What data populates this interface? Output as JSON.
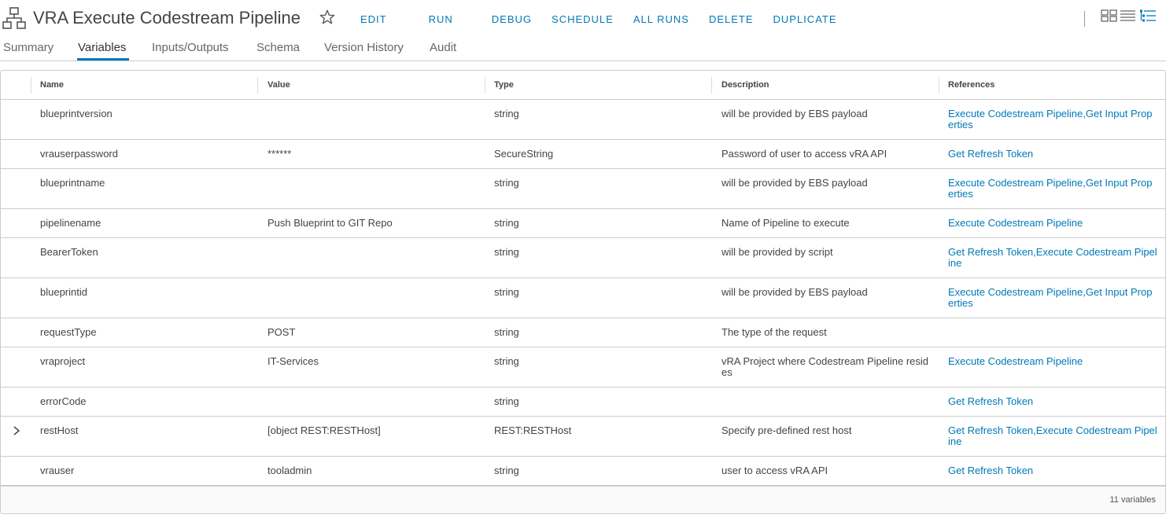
{
  "header": {
    "title": "VRA Execute Codestream Pipeline",
    "actions": [
      "EDIT",
      "RUN",
      "DEBUG",
      "SCHEDULE",
      "ALL RUNS",
      "DELETE",
      "DUPLICATE"
    ],
    "icons": [
      "workflow-icon",
      "star-icon",
      "card-view-icon",
      "list-view-icon",
      "detail-view-icon"
    ]
  },
  "tabs": [
    "Summary",
    "Variables",
    "Inputs/Outputs",
    "Schema",
    "Version History",
    "Audit"
  ],
  "active_tab": "Variables",
  "table": {
    "columns": [
      "Name",
      "Value",
      "Type",
      "Description",
      "References"
    ],
    "rows": [
      {
        "name": "blueprintversion",
        "value": "",
        "type": "string",
        "description": "will be provided by EBS payload",
        "references": "Execute Codestream Pipeline,Get Input Properties"
      },
      {
        "name": "vrauserpassword",
        "value": "******",
        "type": "SecureString",
        "description": "Password of user to access vRA API",
        "references": "Get Refresh Token"
      },
      {
        "name": "blueprintname",
        "value": "",
        "type": "string",
        "description": "will be provided by EBS payload",
        "references": "Execute Codestream Pipeline,Get Input Properties"
      },
      {
        "name": "pipelinename",
        "value": "Push Blueprint to GIT Repo",
        "type": "string",
        "description": "Name of Pipeline to execute",
        "references": "Execute Codestream Pipeline"
      },
      {
        "name": "BearerToken",
        "value": "",
        "type": "string",
        "description": "will be provided by script",
        "references": "Get Refresh Token,Execute Codestream Pipeline"
      },
      {
        "name": "blueprintid",
        "value": "",
        "type": "string",
        "description": "will be provided by EBS payload",
        "references": "Execute Codestream Pipeline,Get Input Properties"
      },
      {
        "name": "requestType",
        "value": "POST",
        "type": "string",
        "description": "The type of the request",
        "references": ""
      },
      {
        "name": "vraproject",
        "value": "IT-Services",
        "type": "string",
        "description": "vRA Project where Codestream Pipeline resides",
        "references": "Execute Codestream Pipeline"
      },
      {
        "name": "errorCode",
        "value": "",
        "type": "string",
        "description": "",
        "references": "Get Refresh Token"
      },
      {
        "name": "restHost",
        "value": "[object REST:RESTHost]",
        "type": "REST:RESTHost",
        "description": "Specify pre-defined rest host",
        "references": "Get Refresh Token,Execute Codestream Pipeline",
        "expandable": true
      },
      {
        "name": "vrauser",
        "value": "tooladmin",
        "type": "string",
        "description": "user to access vRA API",
        "references": "Get Refresh Token"
      }
    ],
    "footer": "11 variables"
  },
  "colors": {
    "accent": "#0079b8",
    "border": "#cccccc",
    "text": "#444444"
  }
}
